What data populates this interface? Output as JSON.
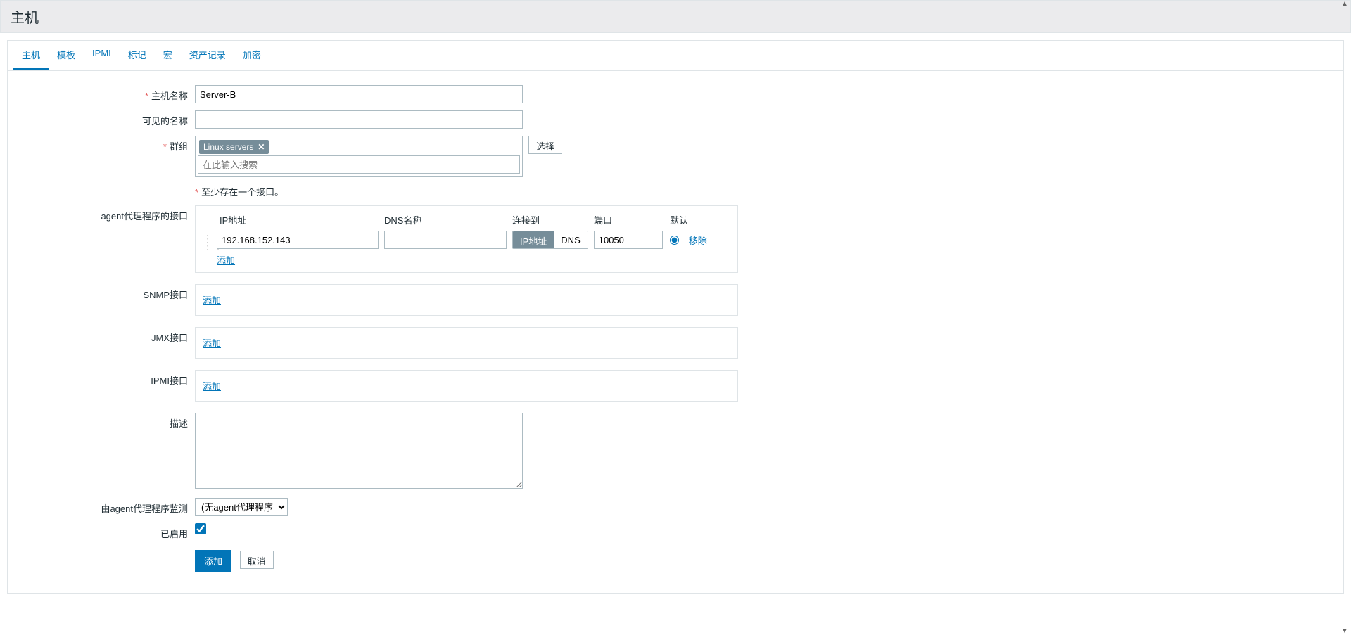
{
  "header": {
    "title": "主机"
  },
  "tabs": {
    "host": "主机",
    "templates": "模板",
    "ipmi": "IPMI",
    "tags": "标记",
    "macros": "宏",
    "inventory": "资产记录",
    "encryption": "加密"
  },
  "labels": {
    "host_name": "主机名称",
    "visible_name": "可见的名称",
    "groups": "群组",
    "select_btn": "选择",
    "group_placeholder": "在此输入搜索",
    "interface_hint": "至少存在一个接口。",
    "agent_interfaces": "agent代理程序的接口",
    "snmp_interfaces": "SNMP接口",
    "jmx_interfaces": "JMX接口",
    "ipmi_interfaces": "IPMI接口",
    "description": "描述",
    "monitored_by": "由agent代理程序监测",
    "enabled": "已启用"
  },
  "iface_cols": {
    "ip": "IP地址",
    "dns": "DNS名称",
    "connect": "连接到",
    "port": "端口",
    "default": "默认"
  },
  "iface": {
    "toggle_ip": "IP地址",
    "toggle_dns": "DNS",
    "add": "添加",
    "remove": "移除"
  },
  "values": {
    "host_name": "Server-B",
    "visible_name": "",
    "group_tag": "Linux servers",
    "agent_ip": "192.168.152.143",
    "agent_dns": "",
    "agent_port": "10050",
    "description": "",
    "proxy_selected": "(无agent代理程序)"
  },
  "buttons": {
    "submit": "添加",
    "cancel": "取消"
  }
}
